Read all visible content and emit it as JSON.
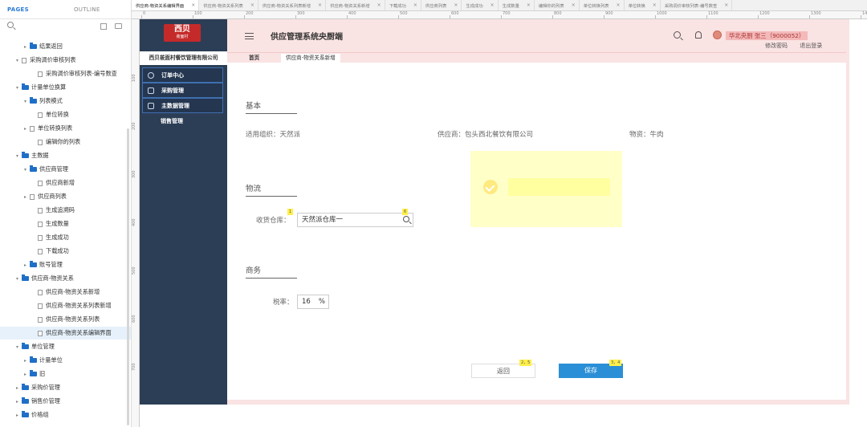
{
  "pages_panel": {
    "tab_pages": "PAGES",
    "tab_outline": "OUTLINE",
    "tree": [
      {
        "label": "结果返回",
        "indent": 1,
        "type": "folder",
        "arrow": "▸"
      },
      {
        "label": "采购调价审核列表",
        "indent": 0,
        "type": "page",
        "arrow": "▾"
      },
      {
        "label": "采购调价审核列表-编号数查",
        "indent": 2,
        "type": "page",
        "arrow": ""
      },
      {
        "label": "计量单位换算",
        "indent": 0,
        "type": "folder",
        "arrow": "▾"
      },
      {
        "label": "列表模式",
        "indent": 1,
        "type": "folder",
        "arrow": "▾"
      },
      {
        "label": "单位转换",
        "indent": 2,
        "type": "page",
        "arrow": ""
      },
      {
        "label": "单位转换列表",
        "indent": 1,
        "type": "page",
        "arrow": "▸"
      },
      {
        "label": "编辑你的列表",
        "indent": 2,
        "type": "page",
        "arrow": ""
      },
      {
        "label": "主数据",
        "indent": 0,
        "type": "folder",
        "arrow": "▾"
      },
      {
        "label": "供应商管理",
        "indent": 1,
        "type": "folder",
        "arrow": "▾"
      },
      {
        "label": "供应商新增",
        "indent": 2,
        "type": "page",
        "arrow": ""
      },
      {
        "label": "供应商列表",
        "indent": 1,
        "type": "page",
        "arrow": "▸"
      },
      {
        "label": "生成追溯码",
        "indent": 2,
        "type": "page",
        "arrow": ""
      },
      {
        "label": "生成数量",
        "indent": 2,
        "type": "page",
        "arrow": ""
      },
      {
        "label": "生成成功",
        "indent": 2,
        "type": "page",
        "arrow": ""
      },
      {
        "label": "下载成功",
        "indent": 2,
        "type": "page",
        "arrow": ""
      },
      {
        "label": "账号管理",
        "indent": 1,
        "type": "folder",
        "arrow": "▸"
      },
      {
        "label": "供应商-物资关系",
        "indent": 0,
        "type": "folder",
        "arrow": "▾"
      },
      {
        "label": "供应商-物资关系新增",
        "indent": 2,
        "type": "page",
        "arrow": ""
      },
      {
        "label": "供应商-物资关系列表新增",
        "indent": 2,
        "type": "page",
        "arrow": ""
      },
      {
        "label": "供应商-物资关系列表",
        "indent": 2,
        "type": "page",
        "arrow": ""
      },
      {
        "label": "供应商-物资关系编辑界面",
        "indent": 2,
        "type": "page",
        "arrow": "",
        "selected": true
      },
      {
        "label": "单位管理",
        "indent": 0,
        "type": "folder",
        "arrow": "▾"
      },
      {
        "label": "计量单位",
        "indent": 1,
        "type": "folder",
        "arrow": "▸"
      },
      {
        "label": "旧",
        "indent": 1,
        "type": "folder",
        "arrow": "▸"
      },
      {
        "label": "采购价管理",
        "indent": 0,
        "type": "folder",
        "arrow": "▸"
      },
      {
        "label": "销售价管理",
        "indent": 0,
        "type": "folder",
        "arrow": "▸"
      },
      {
        "label": "价格组",
        "indent": 0,
        "type": "folder",
        "arrow": "▸"
      }
    ]
  },
  "editor_tabs": [
    {
      "label": "供应商-物资关系编辑界面",
      "active": true
    },
    {
      "label": "供应商-物资关系列表"
    },
    {
      "label": "供应商-物资关系列表新增"
    },
    {
      "label": "供应商-物资关系新增"
    },
    {
      "label": "下载成功"
    },
    {
      "label": "供应商列表"
    },
    {
      "label": "生成成功"
    },
    {
      "label": "生成数量"
    },
    {
      "label": "编辑你的列表"
    },
    {
      "label": "单位转换列表"
    },
    {
      "label": "单位转换"
    },
    {
      "label": "采购调价审核列表-编号数查"
    }
  ],
  "ruler": {
    "h_labels": [
      "0",
      "100",
      "200",
      "300",
      "400",
      "500",
      "600",
      "700",
      "800",
      "900",
      "1000",
      "1100",
      "1200",
      "1300",
      "1400"
    ],
    "v_labels": [
      "100",
      "200",
      "300",
      "400",
      "500",
      "600",
      "700"
    ]
  },
  "app": {
    "logo_main": "西贝",
    "logo_sub": "莜面村",
    "company": "西贝莜面村餐饮管理有限公司",
    "menu": [
      "订单中心",
      "采购管理",
      "主数据管理",
      "销售管理"
    ],
    "title": "供应管理系统央厨端",
    "user": "华北央厨 张三（9000052）",
    "link_change_password": "修改密码",
    "link_logout": "退出登录",
    "tab_home": "首页",
    "tab_current": "供应商-物资关系新增"
  },
  "form": {
    "section_basic": "基本",
    "org_label": "适用组织：天然派",
    "supplier_label": "供应商：包头西北餐饮有限公司",
    "material_label": "物资：牛肉",
    "section_logistics": "物流",
    "warehouse_label": "收货仓库：",
    "warehouse_value": "天然派仓库一",
    "section_business": "商务",
    "tax_label": "税率：",
    "tax_value": "16",
    "tax_unit": "%",
    "back_label": "返回",
    "save_label": "保存",
    "badge_1": "1",
    "badge_2": "6",
    "badge_3": "2，5",
    "badge_4": "3，4"
  }
}
